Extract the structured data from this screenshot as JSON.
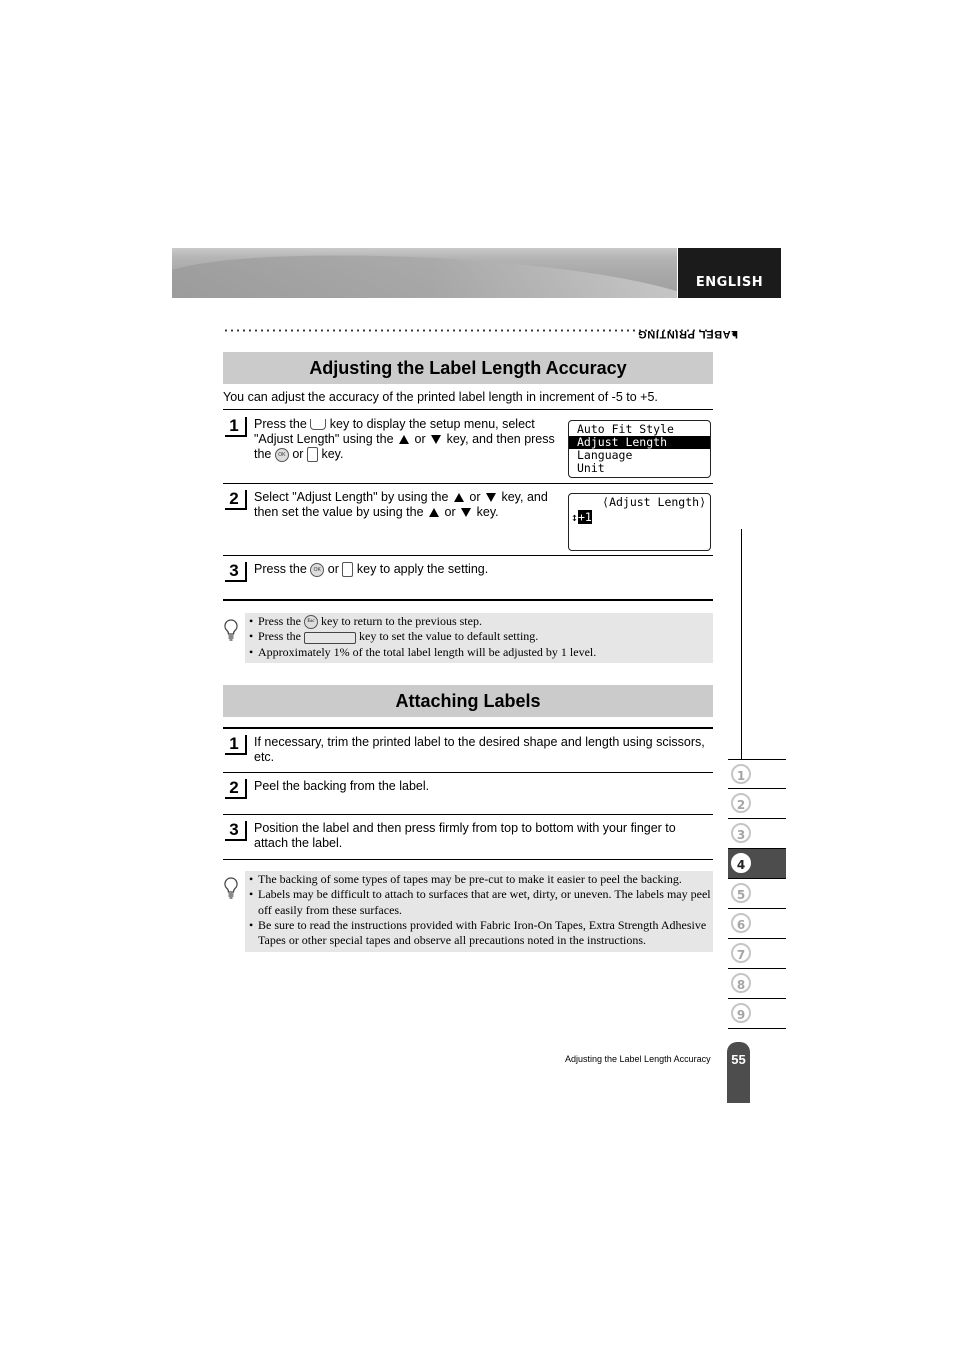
{
  "header": {
    "language_tab": "ENGLISH"
  },
  "side": {
    "section_label": "LABEL PRINTING",
    "chapters": [
      "1",
      "2",
      "3",
      "4",
      "5",
      "6",
      "7",
      "8",
      "9"
    ],
    "active_chapter": "4"
  },
  "section1": {
    "title": "Adjusting the Label Length Accuracy",
    "intro": "You can adjust the accuracy of the printed label length in increment of -5 to +5.",
    "steps": [
      {
        "num": "1",
        "line1a": "Press the",
        "line1b": "key to display the setup menu, select",
        "line2a": "\"Adjust Length\" using the",
        "line2b": "or",
        "line2c": "key, and then press",
        "line3a": "the",
        "line3b": "or",
        "line3c": "key."
      },
      {
        "num": "2",
        "line1a": "Select \"Adjust Length\" by using the",
        "line1b": "or",
        "line1c": "key, and",
        "line2a": "then set the value by using the",
        "line2b": "or",
        "line2c": "key."
      },
      {
        "num": "3",
        "line1a": "Press the",
        "line1b": "or",
        "line1c": "key to apply the setting."
      }
    ],
    "lcd1": [
      "Auto Fit Style",
      "Adjust Length",
      "Language",
      "Unit"
    ],
    "lcd1_selected": "Adjust Length",
    "lcd2": {
      "title": "⟨Adjust Length⟩",
      "value": "+1"
    },
    "notes": {
      "n1a": "Press the",
      "n1b": "key to return to the previous step.",
      "n2a": "Press the",
      "n2b": "key to set the value to default setting.",
      "n3": "Approximately 1% of the total label length will be adjusted by 1 level."
    }
  },
  "section2": {
    "title": "Attaching Labels",
    "steps": [
      {
        "num": "1",
        "text": "If necessary, trim the printed label to the desired shape and length using scissors, etc."
      },
      {
        "num": "2",
        "text": "Peel the backing from the label."
      },
      {
        "num": "3",
        "text": "Position the label and then press firmly from top to bottom with your finger to attach the label."
      }
    ],
    "notes": [
      "The backing of some types of tapes may be pre-cut to make it easier to peel the backing.",
      "Labels may be difficult to attach to surfaces that are wet, dirty, or uneven.  The labels may peel off easily from these surfaces.",
      "Be sure to read the instructions provided with Fabric Iron-On Tapes, Extra Strength Adhesive Tapes or other special tapes and observe all precautions noted in the instructions."
    ]
  },
  "footer": {
    "section_name": "Adjusting the Label Length Accuracy",
    "page_number": "55"
  }
}
